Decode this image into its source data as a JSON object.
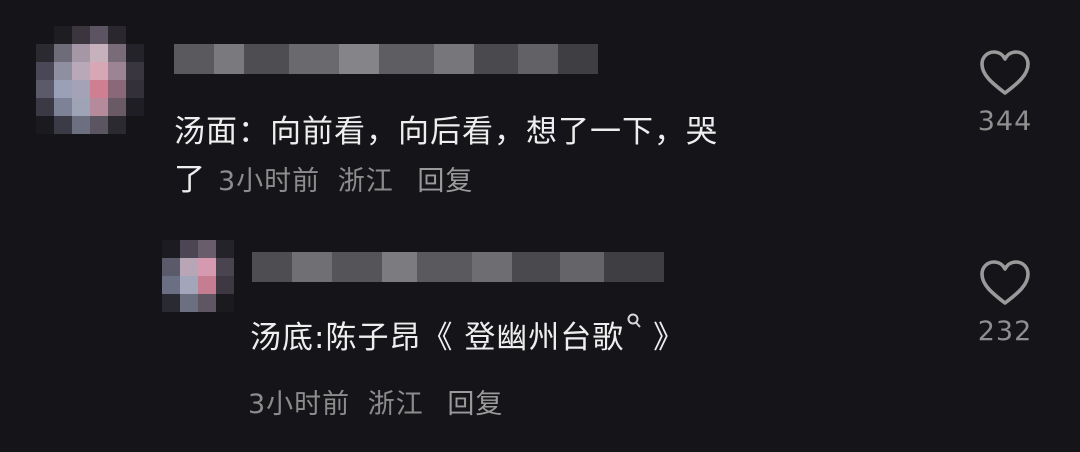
{
  "comments": [
    {
      "text_line1": "汤面：向前看，向后看，想了一下，哭",
      "text_line2": "了",
      "time": "3小时前",
      "location": "浙江",
      "reply_label": "回复",
      "like_count": "344",
      "like_icon": "heart-outline-icon"
    },
    {
      "text_a": "汤底:陈子昂《 ",
      "text_link": "登幽州台歌",
      "search_icon": "search-icon",
      "text_b": " 》",
      "time": "3小时前",
      "location": "浙江",
      "reply_label": "回复",
      "like_count": "232",
      "like_icon": "heart-outline-icon"
    }
  ],
  "colors": {
    "background": "#151519",
    "text": "#eeeeee",
    "meta": "#8c8c8c",
    "icon": "#9a9a9a"
  }
}
